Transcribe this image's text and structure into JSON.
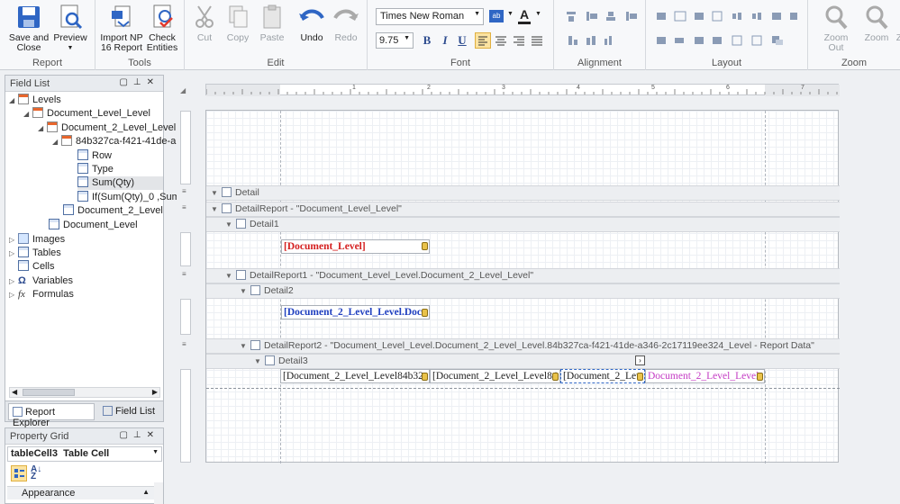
{
  "ribbon": {
    "groups": [
      {
        "label": "Report",
        "buttons": [
          "Save and\nClose",
          "Preview"
        ]
      },
      {
        "label": "Tools",
        "buttons": [
          "Import NP\n16 Report",
          "Check\nEntities"
        ]
      },
      {
        "label": "Edit",
        "buttons": [
          "Cut",
          "Copy",
          "Paste",
          "Undo",
          "Redo"
        ]
      },
      {
        "label": "Font"
      },
      {
        "label": "Alignment"
      },
      {
        "label": "Layout"
      },
      {
        "label": "Zoom",
        "buttons": [
          "Zoom Out",
          "Zoom",
          "Z"
        ]
      }
    ],
    "font_name": "Times New Roman",
    "font_size": "9.75",
    "bold": "B",
    "italic": "I",
    "underline": "U"
  },
  "field_list": {
    "title": "Field List",
    "tree": [
      "Levels",
      "Document_Level_Level",
      "Document_2_Level_Level",
      "84b327ca-f421-41de-a",
      "Row",
      "Type",
      "Sum(Qty)",
      "If(Sum(Qty)_0 ,Sum",
      "Document_2_Level",
      "Document_Level",
      "Images",
      "Tables",
      "Cells",
      "Variables",
      "Formulas"
    ],
    "tabs": [
      "Report Explorer",
      "Field List"
    ]
  },
  "property_grid": {
    "title": "Property Grid",
    "selected": "tableCell3",
    "selected_type": "Table Cell",
    "category": "Appearance"
  },
  "bands": {
    "detail": "Detail",
    "detail_report": "DetailReport - \"Document_Level_Level\"",
    "detail1": "Detail1",
    "detail_report1": "DetailReport1 - \"Document_Level_Level.Document_2_Level_Level\"",
    "detail2": "Detail2",
    "detail_report2": "DetailReport2 - \"Document_Level_Level.Document_2_Level_Level.84b327ca-f421-41de-a346-2c17119ee324_Level - Report Data\"",
    "detail3": "Detail3"
  },
  "cells": {
    "c1": "[Document_Level]",
    "c2": "[Document_2_Level_Level.Docu",
    "c3a": "[Document_2_Level_Level84b32",
    "c3b": "[Document_2_Level_Level84",
    "c3c": "[Document_2_Lev",
    "c3d": "Document_2_Level_Level",
    "ruler_nums": [
      "1",
      "2",
      "3",
      "4",
      "5",
      "6",
      "7"
    ]
  },
  "colors": {
    "c1": "#d42020",
    "c2": "#1f3fbf",
    "c3d": "#c43bc4"
  }
}
